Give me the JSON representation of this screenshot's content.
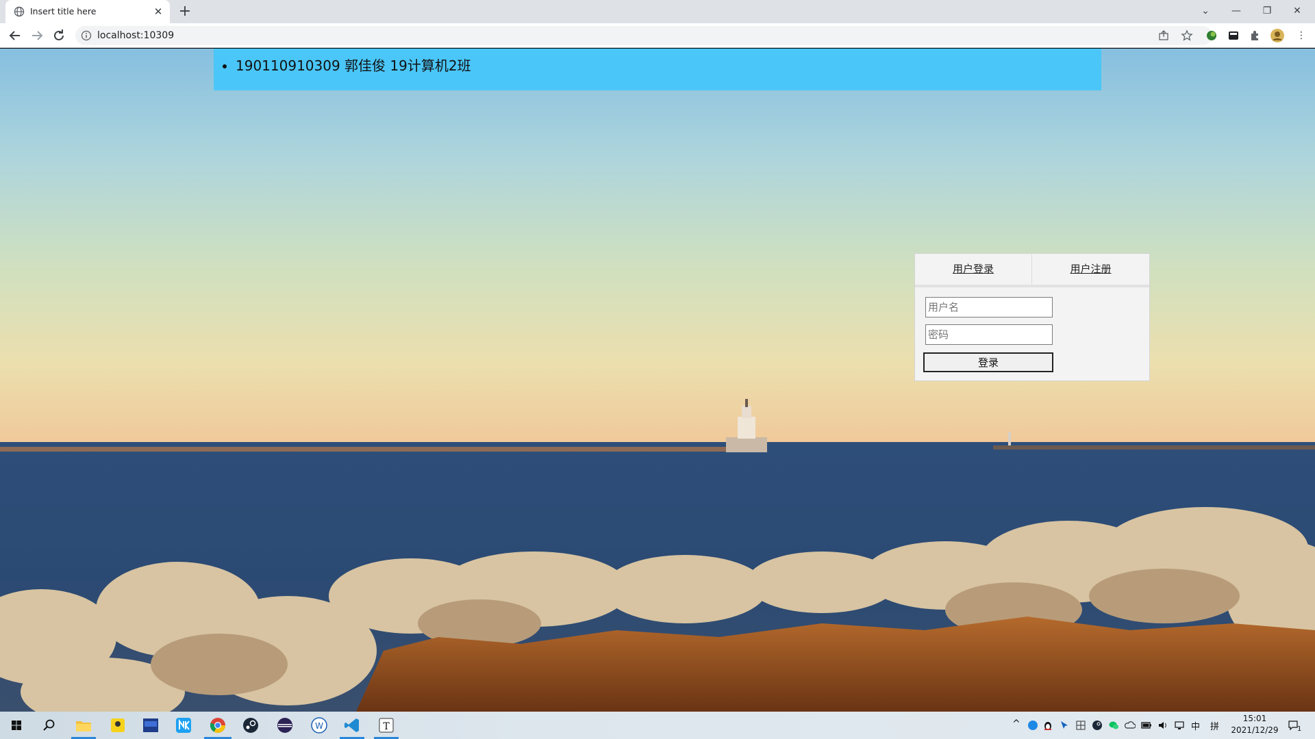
{
  "browser": {
    "tab_title": "Insert title here",
    "url": "localhost:10309"
  },
  "page": {
    "header_item": "190110910309 郭佳俊 19计算机2班",
    "login": {
      "tab_login": "用户登录",
      "tab_register": "用户注册",
      "username_placeholder": "用户名",
      "password_placeholder": "密码",
      "submit_label": "登录"
    }
  },
  "taskbar": {
    "ime_label": "中",
    "layout_label": "拼",
    "time": "15:01",
    "date": "2021/12/29",
    "notification_count": "1"
  },
  "colors": {
    "header_bar": "#4ac6f8",
    "login_panel": "#f3f3f3",
    "tab_bar": "#dee1e6"
  }
}
